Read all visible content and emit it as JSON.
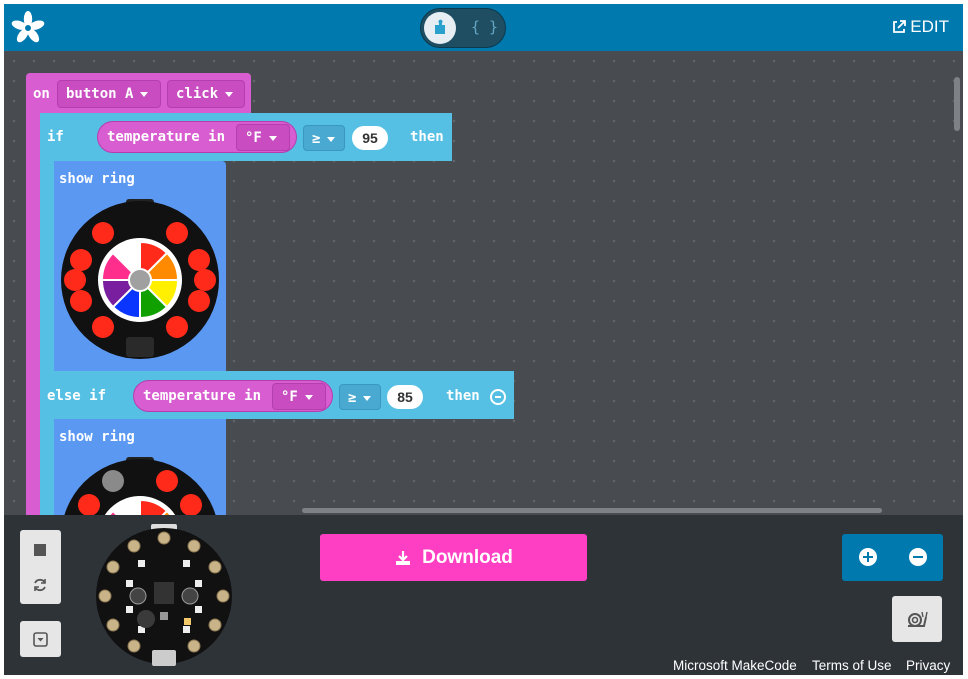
{
  "header": {
    "edit_label": "EDIT",
    "code_toggle_braces": "{ }",
    "colors": {
      "bar": "#0079ae"
    }
  },
  "blocks": {
    "event": {
      "on": "on",
      "button": "button A",
      "action": "click"
    },
    "if_block": {
      "keyword": "if",
      "sensor": "temperature in",
      "unit": "°F",
      "operator": "≥",
      "value": "95",
      "then": "then"
    },
    "show_ring_1": {
      "label": "show ring"
    },
    "else_if_block": {
      "keyword": "else if",
      "sensor": "temperature in",
      "unit": "°F",
      "operator": "≥",
      "value": "85",
      "then": "then"
    },
    "show_ring_2": {
      "label": "show ring"
    }
  },
  "bottom": {
    "download_label": "Download",
    "download_color": "#ff3fc3"
  },
  "footer": {
    "makecode": "Microsoft MakeCode",
    "terms": "Terms of Use",
    "privacy": "Privacy"
  }
}
